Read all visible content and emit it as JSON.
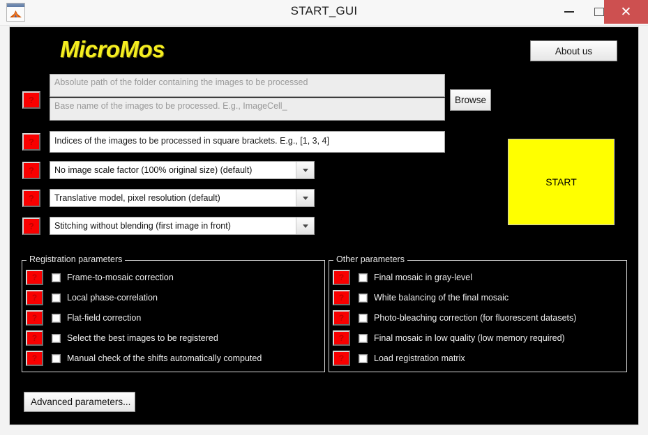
{
  "window": {
    "title": "START_GUI",
    "icon": "matlab-icon",
    "controls": {
      "minimize": "minimize-icon",
      "maximize": "maximize-icon",
      "close": "✕"
    }
  },
  "app": {
    "logo": "MicroMos",
    "logo_color": "#f5ee20",
    "background": "#000000"
  },
  "about": {
    "label": "About us"
  },
  "help_symbol": "?",
  "path_fields": {
    "folder": {
      "placeholder": "Absolute path of the folder containing the images to be processed",
      "value": ""
    },
    "basename": {
      "placeholder": "Base name of the images to be processed. E.g., ImageCell_",
      "value": ""
    },
    "browse_label": "Browse"
  },
  "indices_field": {
    "value": "Indices of the images to be processed in square brackets. E.g., [1, 3, 4]"
  },
  "dropdowns": [
    {
      "name": "scale-factor",
      "value": "No image scale factor (100% original size) (default)"
    },
    {
      "name": "registration-model",
      "value": "Translative model, pixel resolution (default)"
    },
    {
      "name": "blending-mode",
      "value": "Stitching without blending (first image in front)"
    }
  ],
  "start": {
    "label": "START",
    "color": "#ffff00"
  },
  "registration_panel": {
    "legend": "Registration parameters",
    "items": [
      {
        "label": "Frame-to-mosaic correction",
        "checked": false
      },
      {
        "label": "Local phase-correlation",
        "checked": false
      },
      {
        "label": "Flat-field correction",
        "checked": false
      },
      {
        "label": "Select the best images to be registered",
        "checked": false
      },
      {
        "label": "Manual check of the shifts automatically computed",
        "checked": false
      }
    ]
  },
  "other_panel": {
    "legend": "Other parameters",
    "items": [
      {
        "label": "Final mosaic in gray-level",
        "checked": false
      },
      {
        "label": "White balancing of the final mosaic",
        "checked": false
      },
      {
        "label": "Photo-bleaching correction (for fluorescent datasets)",
        "checked": false
      },
      {
        "label": "Final mosaic in low quality (low memory required)",
        "checked": false
      },
      {
        "label": "Load registration matrix",
        "checked": false
      }
    ]
  },
  "advanced": {
    "label": "Advanced parameters..."
  }
}
